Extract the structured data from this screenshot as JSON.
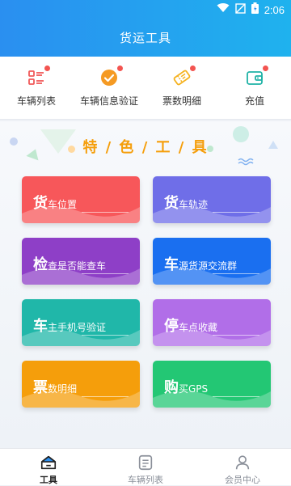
{
  "status_bar": {
    "time": "2:06"
  },
  "header": {
    "title": "货运工具"
  },
  "top_tools": [
    {
      "label": "车辆列表",
      "icon": "list-icon",
      "has_badge": true
    },
    {
      "label": "车辆信息验证",
      "icon": "check-circle-icon",
      "has_badge": true
    },
    {
      "label": "票数明细",
      "icon": "ticket-icon",
      "has_badge": true
    },
    {
      "label": "充值",
      "icon": "wallet-icon",
      "has_badge": true
    }
  ],
  "feature": {
    "title": "特 / 色 / 工 / 具",
    "cards": [
      {
        "big": "货",
        "rest": "车位置",
        "color": "#f7575a"
      },
      {
        "big": "货",
        "rest": "车轨迹",
        "color": "#6f6ee8"
      },
      {
        "big": "检",
        "rest": "查是否能查车",
        "color": "#8e3fc7"
      },
      {
        "big": "车",
        "rest": "源货源交流群",
        "color": "#1a6ff0"
      },
      {
        "big": "车",
        "rest": "主手机号验证",
        "color": "#20b7a9"
      },
      {
        "big": "停",
        "rest": "车点收藏",
        "color": "#b16ee8"
      },
      {
        "big": "票",
        "rest": "数明细",
        "color": "#f59e0b"
      },
      {
        "big": "购",
        "rest": "买GPS",
        "color": "#23c774"
      }
    ]
  },
  "bottom_nav": [
    {
      "label": "工具",
      "icon": "home-icon",
      "active": true
    },
    {
      "label": "车辆列表",
      "icon": "list-icon",
      "active": false
    },
    {
      "label": "会员中心",
      "icon": "user-icon",
      "active": false
    }
  ]
}
